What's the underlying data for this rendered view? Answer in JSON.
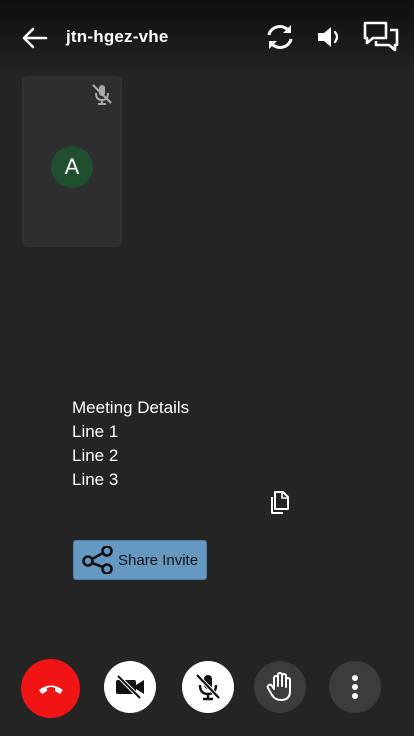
{
  "header": {
    "meeting_name": "jtn-hgez-vhe",
    "icons": [
      "back-arrow-icon",
      "switch-camera-icon",
      "speaker-icon",
      "chat-icon"
    ]
  },
  "participant": {
    "initial": "A",
    "avatar_color": "#1f4f2f",
    "muted": true
  },
  "details": {
    "heading": "Meeting Details",
    "lines": [
      "Line 1",
      "Line 2",
      "Line 3"
    ]
  },
  "share": {
    "label": "Share Invite",
    "color": "#6699c2"
  },
  "controls": {
    "hangup_color": "#f01414",
    "items": [
      "end-call",
      "camera-off",
      "mic-off",
      "raise-hand",
      "more-options"
    ]
  }
}
